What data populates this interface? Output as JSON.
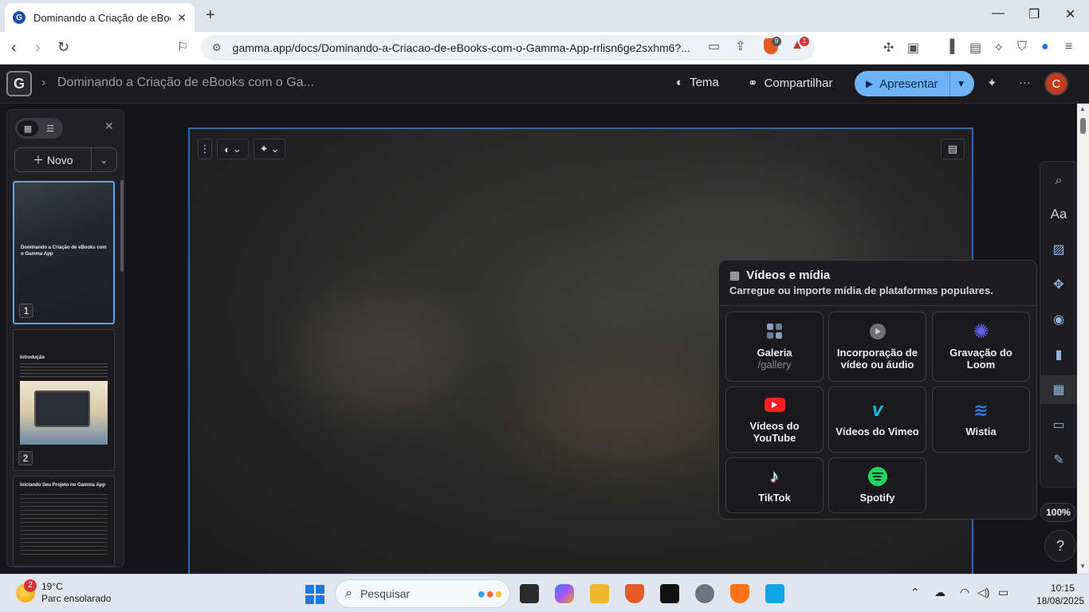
{
  "browser": {
    "tab_title": "Dominando a Criação de eBooks",
    "url": "gamma.app/docs/Dominando-a-Criacao-de-eBooks-com-o-Gamma-App-rrlisn6ge2sxhm6?...",
    "brave_badge": "9",
    "alert_badge": "1"
  },
  "app": {
    "logo": "G",
    "doc_title": "Dominando a Criação de eBooks com o Ga...",
    "theme_label": "Tema",
    "share_label": "Compartilhar",
    "present_label": "Apresentar",
    "avatar_letter": "C"
  },
  "left_panel": {
    "new_label": "Novo",
    "slides": [
      {
        "number": "1",
        "title": "Dominando a Criação de eBooks com o Gamma App"
      },
      {
        "number": "2",
        "title": "Introdução"
      },
      {
        "number": "",
        "title": "Iniciando Seu Projeto no Gamma App"
      }
    ]
  },
  "media_panel": {
    "title": "Vídeos e mídia",
    "subtitle": "Carregue ou importe mídia de plataformas populares.",
    "tiles": [
      {
        "label": "Galeria",
        "sub": "/gallery",
        "icon": "gallery-icon"
      },
      {
        "label": "Incorporação de vídeo ou áudio",
        "icon": "play-circle-icon"
      },
      {
        "label": "Gravação do Loom",
        "icon": "loom-icon"
      },
      {
        "label": "Vídeos do YouTube",
        "icon": "youtube-icon"
      },
      {
        "label": "Vídeos do Vimeo",
        "icon": "vimeo-icon"
      },
      {
        "label": "Wistia",
        "icon": "wistia-icon"
      },
      {
        "label": "TikTok",
        "icon": "tiktok-icon"
      },
      {
        "label": "Spotify",
        "icon": "spotify-icon"
      }
    ]
  },
  "zoom": "100%",
  "help": "?",
  "taskbar": {
    "temperature": "19°C",
    "weather_desc": "Parc ensolarado",
    "weather_badge": "2",
    "search_placeholder": "Pesquisar",
    "time": "10:15",
    "date": "18/08/2025"
  },
  "colors": {
    "accent": "#6db4f7",
    "card_border": "#2f6ba3",
    "youtube": "#ff1f1f",
    "spotify": "#1ed760",
    "loom": "#625df5",
    "vimeo": "#1ab7ea",
    "wistia": "#2b7de9"
  }
}
